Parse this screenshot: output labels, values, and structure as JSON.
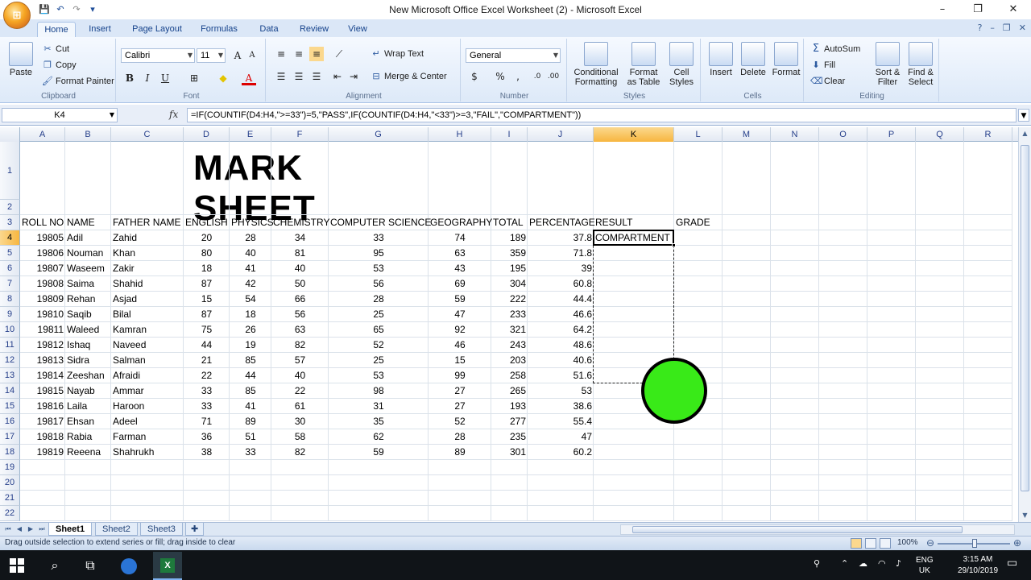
{
  "window": {
    "title": "New Microsoft Office Excel Worksheet (2) - Microsoft Excel",
    "minimize": "–",
    "restore": "❐",
    "close": "✕"
  },
  "qat": {
    "save": "💾",
    "undo": "↶",
    "redo": "↷",
    "customize": "▾"
  },
  "ribbon_tabs": [
    {
      "label": "Home",
      "active": true
    },
    {
      "label": "Insert"
    },
    {
      "label": "Page Layout"
    },
    {
      "label": "Formulas"
    },
    {
      "label": "Data"
    },
    {
      "label": "Review"
    },
    {
      "label": "View"
    }
  ],
  "ribbon": {
    "clipboard": {
      "label": "Clipboard",
      "paste": "Paste",
      "cut": "Cut",
      "copy": "Copy",
      "format_painter": "Format Painter"
    },
    "font": {
      "label": "Font",
      "name": "Calibri",
      "size": "11",
      "bold": "B",
      "italic": "I",
      "underline": "U"
    },
    "alignment": {
      "label": "Alignment",
      "wrap_text": "Wrap Text",
      "merge_center": "Merge & Center"
    },
    "number": {
      "label": "Number",
      "format": "General",
      "percent": "%",
      "comma": ","
    },
    "styles": {
      "label": "Styles",
      "conditional": "Conditional",
      "conditional2": "Formatting",
      "format_table": "Format",
      "format_table2": "as Table",
      "cell_styles": "Cell",
      "cell_styles2": "Styles"
    },
    "cells": {
      "label": "Cells",
      "insert": "Insert",
      "delete": "Delete",
      "format": "Format"
    },
    "editing": {
      "label": "Editing",
      "autosum": "AutoSum",
      "fill": "Fill",
      "clear": "Clear",
      "sort": "Sort &",
      "sort2": "Filter",
      "find": "Find &",
      "find2": "Select"
    }
  },
  "formula_bar": {
    "name_box": "K4",
    "fx": "fx",
    "formula": "=IF(COUNTIF(D4:H4,\">=33\")=5,\"PASS\",IF(COUNTIF(D4:H4,\"<33\")>=3,\"FAIL\",\"COMPARTMENT\"))"
  },
  "columns": [
    "A",
    "B",
    "C",
    "D",
    "E",
    "F",
    "G",
    "H",
    "I",
    "J",
    "K",
    "L",
    "M",
    "N",
    "O",
    "P",
    "Q",
    "R"
  ],
  "rows": [
    "1",
    "2",
    "3",
    "4",
    "5",
    "6",
    "7",
    "8",
    "9",
    "10",
    "11",
    "12",
    "13",
    "14",
    "15",
    "16",
    "17",
    "18",
    "19",
    "20",
    "21",
    "22"
  ],
  "sheet": {
    "title": "MARK SHEET",
    "headers": [
      "ROLL NO",
      "NAME",
      "FATHER NAME",
      "ENGLISH",
      "PHYSICS",
      "CHEMISTRY",
      "COMPUTER SCIENCE",
      "GEOGRAPHY",
      "TOTAL",
      "PERCENTAGE",
      "RESULT",
      "GRADE"
    ],
    "records": [
      [
        "19805",
        "Adil",
        "Zahid",
        "20",
        "28",
        "34",
        "33",
        "74",
        "189",
        "37.8",
        "COMPARTMENT"
      ],
      [
        "19806",
        "Nouman",
        "Khan",
        "80",
        "40",
        "81",
        "95",
        "63",
        "359",
        "71.8",
        ""
      ],
      [
        "19807",
        "Waseem",
        "Zakir",
        "18",
        "41",
        "40",
        "53",
        "43",
        "195",
        "39",
        ""
      ],
      [
        "19808",
        "Saima",
        "Shahid",
        "87",
        "42",
        "50",
        "56",
        "69",
        "304",
        "60.8",
        ""
      ],
      [
        "19809",
        "Rehan",
        "Asjad",
        "15",
        "54",
        "66",
        "28",
        "59",
        "222",
        "44.4",
        ""
      ],
      [
        "19810",
        "Saqib",
        "Bilal",
        "87",
        "18",
        "56",
        "25",
        "47",
        "233",
        "46.6",
        ""
      ],
      [
        "19811",
        "Waleed",
        "Kamran",
        "75",
        "26",
        "63",
        "65",
        "92",
        "321",
        "64.2",
        ""
      ],
      [
        "19812",
        "Ishaq",
        "Naveed",
        "44",
        "19",
        "82",
        "52",
        "46",
        "243",
        "48.6",
        ""
      ],
      [
        "19813",
        "Sidra",
        "Salman",
        "21",
        "85",
        "57",
        "25",
        "15",
        "203",
        "40.6",
        ""
      ],
      [
        "19814",
        "Zeeshan",
        "Afraidi",
        "22",
        "44",
        "40",
        "53",
        "99",
        "258",
        "51.6",
        ""
      ],
      [
        "19815",
        "Nayab",
        "Ammar",
        "33",
        "85",
        "22",
        "98",
        "27",
        "265",
        "53",
        ""
      ],
      [
        "19816",
        "Laila",
        "Haroon",
        "33",
        "41",
        "61",
        "31",
        "27",
        "193",
        "38.6",
        ""
      ],
      [
        "19817",
        "Ehsan",
        "Adeel",
        "71",
        "89",
        "30",
        "35",
        "52",
        "277",
        "55.4",
        ""
      ],
      [
        "19818",
        "Rabia",
        "Farman",
        "36",
        "51",
        "58",
        "62",
        "28",
        "235",
        "47",
        ""
      ],
      [
        "19819",
        "Reeena",
        "Shahrukh",
        "38",
        "33",
        "82",
        "59",
        "89",
        "301",
        "60.2",
        ""
      ]
    ]
  },
  "sheet_tabs": [
    {
      "label": "Sheet1",
      "active": true
    },
    {
      "label": "Sheet2"
    },
    {
      "label": "Sheet3"
    }
  ],
  "status": {
    "message": "Drag outside selection to extend series or fill; drag inside to clear",
    "zoom": "100%"
  },
  "taskbar": {
    "lang1": "ENG",
    "lang2": "UK",
    "time": "3:15 AM",
    "date": "29/10/2019"
  },
  "colors": {
    "accent": "#f7b640",
    "cursor": "#39ea18"
  }
}
